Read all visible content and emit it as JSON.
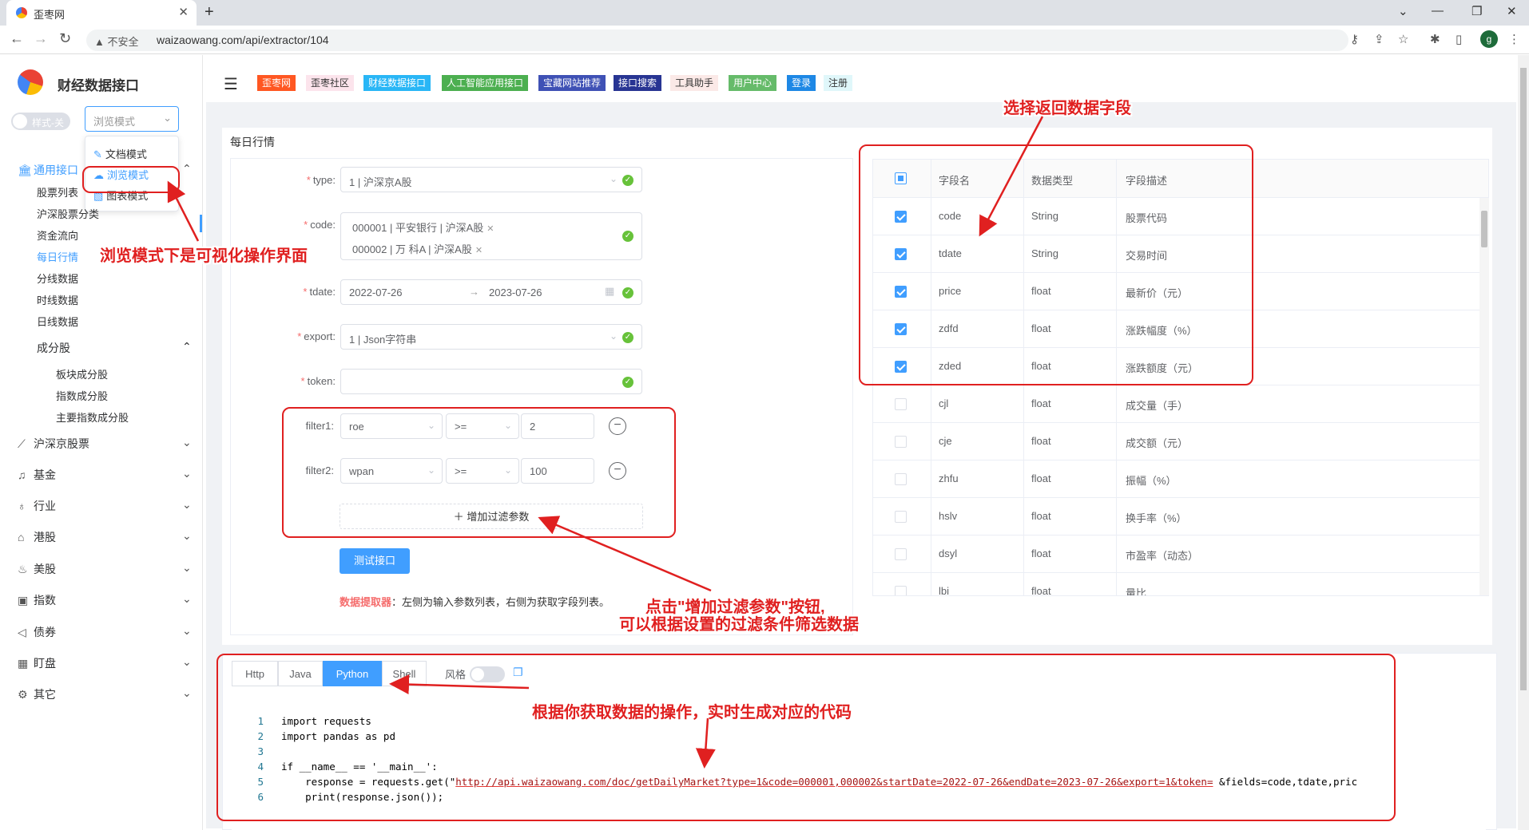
{
  "browser": {
    "tab_title": "歪枣网",
    "insecure_label": "不安全",
    "url": "waizaowang.com/api/extractor/104",
    "profile_initial": "g"
  },
  "sidebar": {
    "app_title": "财经数据接口",
    "style_toggle_label": "样式-关",
    "mode_select_value": "浏览模式",
    "mode_options": [
      "文档模式",
      "浏览模式",
      "图表模式"
    ],
    "groups": [
      {
        "label": "通用接口"
      },
      {
        "label": "沪深京股票"
      },
      {
        "label": "基金"
      },
      {
        "label": "行业"
      },
      {
        "label": "港股"
      },
      {
        "label": "美股"
      },
      {
        "label": "指数"
      },
      {
        "label": "债券"
      },
      {
        "label": "盯盘"
      },
      {
        "label": "其它"
      }
    ],
    "sub_items": [
      "股票列表",
      "沪深股票分类",
      "资金流向",
      "每日行情",
      "分线数据",
      "时线数据",
      "日线数据",
      "成分股"
    ],
    "subsub_items": [
      "板块成分股",
      "指数成分股",
      "主要指数成分股"
    ]
  },
  "topnav": [
    {
      "label": "歪枣网",
      "bg": "#ff5722",
      "fg": "#ffffff"
    },
    {
      "label": "歪枣社区",
      "bg": "#fce4ec",
      "fg": "#333333"
    },
    {
      "label": "财经数据接口",
      "bg": "#29b6f6",
      "fg": "#ffffff"
    },
    {
      "label": "人工智能应用接口",
      "bg": "#4caf50",
      "fg": "#ffffff"
    },
    {
      "label": "宝藏网站推荐",
      "bg": "#3f51b5",
      "fg": "#ffffff"
    },
    {
      "label": "接口搜索",
      "bg": "#283593",
      "fg": "#ffffff"
    },
    {
      "label": "工具助手",
      "bg": "#fbe9e7",
      "fg": "#333333"
    },
    {
      "label": "用户中心",
      "bg": "#66bb6a",
      "fg": "#ffffff"
    },
    {
      "label": "登录",
      "bg": "#1e88e5",
      "fg": "#ffffff"
    },
    {
      "label": "注册",
      "bg": "#e0f7fa",
      "fg": "#333333"
    }
  ],
  "main": {
    "section_title": "每日行情",
    "form": {
      "type_label": "type:",
      "type_value": "1 | 沪深京A股",
      "code_label": "code:",
      "code_tags": [
        "000001 | 平安银行 | 沪深A股",
        "000002 | 万  科A | 沪深A股"
      ],
      "tdate_label": "tdate:",
      "tdate_start": "2022-07-26",
      "tdate_end": "2023-07-26",
      "export_label": "export:",
      "export_value": "1 | Json字符串",
      "token_label": "token:",
      "token_value": "",
      "filter1_label": "filter1:",
      "filter1": {
        "field": "roe",
        "op": ">=",
        "value": "2"
      },
      "filter2_label": "filter2:",
      "filter2": {
        "field": "wpan",
        "op": ">=",
        "value": "100"
      },
      "add_filter_label": "增加过滤参数",
      "test_button": "测试接口",
      "tip_bold": "数据提取器",
      "tip_rest": "：左侧为输入参数列表，右侧为获取字段列表。"
    },
    "fields_table": {
      "headers": [
        "字段名",
        "数据类型",
        "字段描述"
      ],
      "rows": [
        {
          "name": "code",
          "type": "String",
          "desc": "股票代码",
          "checked": true
        },
        {
          "name": "tdate",
          "type": "String",
          "desc": "交易时间",
          "checked": true
        },
        {
          "name": "price",
          "type": "float",
          "desc": "最新价（元）",
          "checked": true
        },
        {
          "name": "zdfd",
          "type": "float",
          "desc": "涨跌幅度（%）",
          "checked": true
        },
        {
          "name": "zded",
          "type": "float",
          "desc": "涨跌额度（元）",
          "checked": true
        },
        {
          "name": "cjl",
          "type": "float",
          "desc": "成交量（手）",
          "checked": false
        },
        {
          "name": "cje",
          "type": "float",
          "desc": "成交额（元）",
          "checked": false
        },
        {
          "name": "zhfu",
          "type": "float",
          "desc": "振幅（%）",
          "checked": false
        },
        {
          "name": "hslv",
          "type": "float",
          "desc": "换手率（%）",
          "checked": false
        },
        {
          "name": "dsyl",
          "type": "float",
          "desc": "市盈率（动态）",
          "checked": false
        },
        {
          "name": "lbi",
          "type": "float",
          "desc": "量比",
          "checked": false
        }
      ]
    },
    "code_panel": {
      "tabs": [
        "Http",
        "Java",
        "Python",
        "Shell"
      ],
      "active_tab": "Python",
      "style_label": "风格",
      "lines": [
        "import requests",
        "import pandas as pd",
        "",
        "if __name__ == '__main__':",
        "    response = requests.get(\"",
        "    print(response.json());"
      ],
      "line_numbers": [
        "1",
        "2",
        "3",
        "4",
        "5",
        "6"
      ],
      "request_url": "http://api.waizaowang.com/doc/getDailyMarket?type=1&code=000001,000002&startDate=2022-07-26&endDate=2023-07-26&export=1&token=",
      "request_tail": " &fields=code,tdate,pric"
    }
  },
  "annotations": {
    "select_fields": "选择返回数据字段",
    "browse_mode": "浏览模式下是可视化操作界面",
    "filter_line1": "点击\"增加过滤参数\"按钮,",
    "filter_line2": "可以根据设置的过滤条件筛选数据",
    "code_gen": "根据你获取数据的操作，实时生成对应的代码"
  }
}
